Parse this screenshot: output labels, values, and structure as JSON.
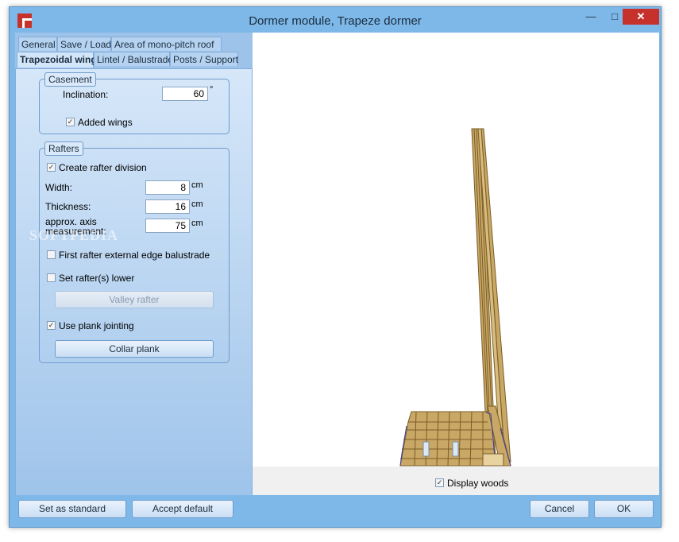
{
  "window": {
    "title": "Dormer module, Trapeze dormer"
  },
  "tabs": {
    "row1": [
      "General",
      "Save / Load",
      "Area of mono-pitch roof"
    ],
    "row2": [
      "Trapezoidal wing",
      "Lintel / Balustrade",
      "Posts / Support"
    ]
  },
  "casement": {
    "title": "Casement",
    "inclination_label": "Inclination:",
    "inclination_value": "60",
    "inclination_unit": "°",
    "added_wings_label": "Added wings"
  },
  "rafters": {
    "title": "Rafters",
    "create_division_label": "Create rafter division",
    "width_label": "Width:",
    "width_value": "8",
    "width_unit": "cm",
    "thickness_label": "Thickness:",
    "thickness_value": "16",
    "thickness_unit": "cm",
    "axis_label": "approx. axis measurement:",
    "axis_value": "75",
    "axis_unit": "cm",
    "first_rafter_label": "First rafter external edge balustrade",
    "set_lower_label": "Set rafter(s) lower",
    "valley_button": "Valley rafter",
    "plank_jointing_label": "Use plank jointing",
    "collar_button": "Collar plank"
  },
  "viewport": {
    "display_woods_label": "Display woods"
  },
  "footer": {
    "set_standard": "Set as standard",
    "accept_default": "Accept default",
    "cancel": "Cancel",
    "ok": "OK"
  },
  "watermark": "SOFTPEDIA",
  "colors": {
    "accent": "#7db8e8",
    "wood": "#c9a866",
    "wood_edge": "#7a5c25",
    "edge_blue": "#3a3aa0"
  }
}
